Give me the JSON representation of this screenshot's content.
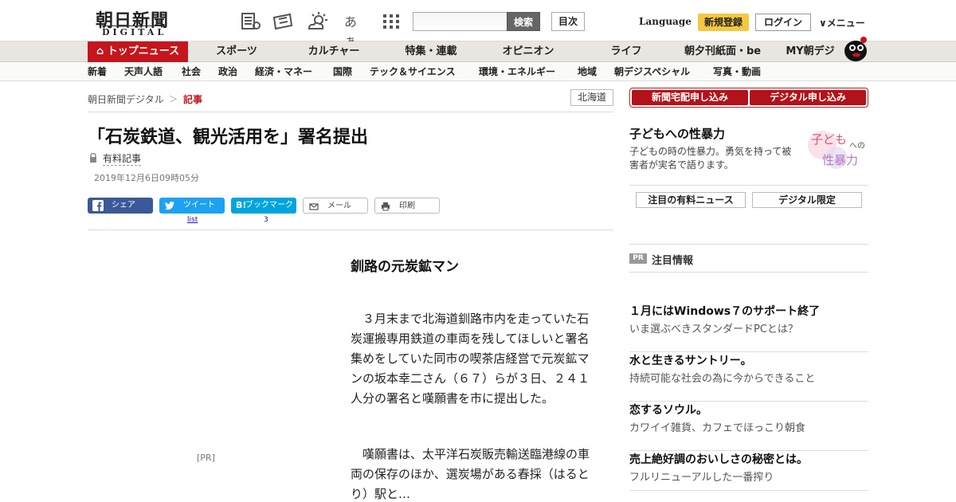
{
  "header": {
    "logo_main": "朝日新聞",
    "logo_sub": "DIGITAL",
    "font_icon_label": "あぁ",
    "search_button": "検索",
    "toc_button": "目次",
    "language": "Language",
    "signup": "新規登録",
    "login": "ログイン",
    "menu": "メニュー"
  },
  "nav_primary": {
    "home": "トップニュース",
    "items": [
      "スポーツ",
      "カルチャー",
      "特集・連載",
      "オピニオン",
      "ライフ",
      "朝夕刊紙面・be",
      "MY朝デジ"
    ]
  },
  "nav_secondary": {
    "items": [
      "新着",
      "天声人語",
      "社会",
      "政治",
      "経済・マネー",
      "国際",
      "テック＆サイエンス",
      "環境・エネルギー",
      "地域",
      "朝デジスペシャル",
      "写真・動画"
    ]
  },
  "breadcrumb": {
    "home": "朝日新聞デジタル",
    "separator": "＞",
    "current": "記事"
  },
  "region": "北海道",
  "article": {
    "title": "「石炭鉄道、観光活用を」署名提出",
    "paid_label": "有料記事",
    "date": "2019年12月6日09時05分",
    "subhead": "釧路の元炭鉱マン",
    "paragraphs": [
      "３月末まで北海道釧路市内を走っていた石炭運搬専用鉄道の車両を残してほしいと署名集めをしていた同市の喫茶店経営で元炭鉱マンの坂本幸二さん（６７）らが３日、２４１人分の署名と嘆願書を市に提出した。",
      "嘆願書は、太平洋石炭販売輸送臨港線の車両の保存のほか、選炭場がある春採（はるとり）駅と…"
    ],
    "pr_label": "[PR]"
  },
  "share": {
    "facebook": "シェア",
    "twitter": "ツイート",
    "twitter_count": "list",
    "hatena": "ブックマーク",
    "hatena_count": "3",
    "mail": "メール",
    "print": "印刷"
  },
  "sidebar": {
    "promo_buttons": [
      "新聞宅配申し込み",
      "デジタル申し込み"
    ],
    "feature": {
      "title": "子どもへの性暴力",
      "description": "子どもの時の性暴力。勇気を持って被害者が実名で語ります。",
      "image_text_1": "子ども",
      "image_text_2": "への",
      "image_text_3": "性暴力"
    },
    "buttons": [
      "注目の有料ニュース",
      "デジタル限定"
    ],
    "pr_badge": "PR",
    "pr_heading": "注目情報",
    "pr_items": [
      {
        "title": "１月にはWindows７のサポート終了",
        "desc": "いま選ぶべきスタンダードPCとは？"
      },
      {
        "title": "水と生きるサントリー。",
        "desc": "持続可能な社会の為に今からできること"
      },
      {
        "title": "恋するソウル。",
        "desc": "カワイイ雑貨、カフェでほっこり朝食"
      },
      {
        "title": "売上絶好調のおいしさの秘密とは。",
        "desc": "フルリニューアルした一番搾り"
      }
    ]
  },
  "colors": {
    "brand_red": "#c4161c",
    "signup_yellow": "#f5c842",
    "facebook": "#3b5998",
    "twitter": "#1da1f2",
    "hatena": "#00a4de"
  }
}
